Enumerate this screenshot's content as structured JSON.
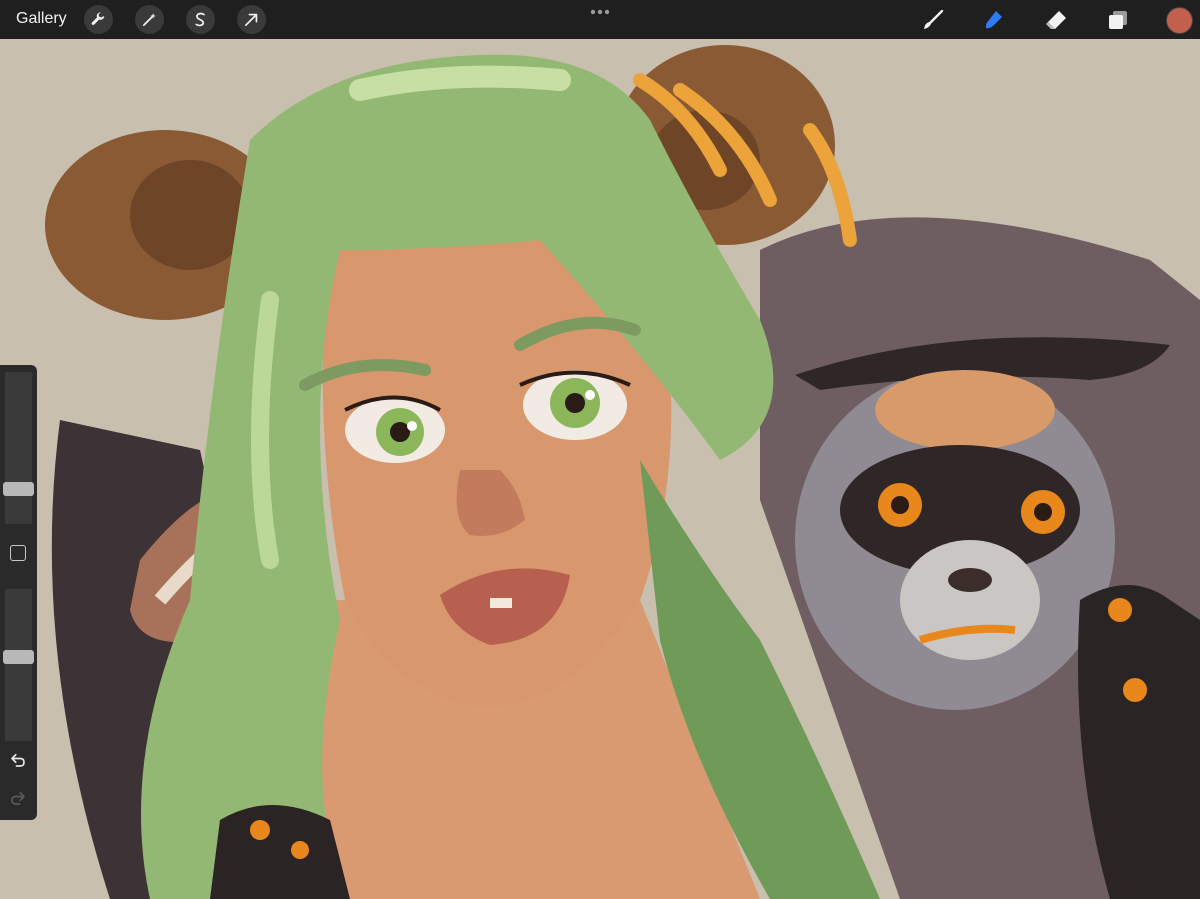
{
  "toolbar": {
    "gallery_label": "Gallery",
    "left_tools": [
      {
        "icon": "wrench-icon"
      },
      {
        "icon": "magic-wand-icon"
      },
      {
        "icon": "selection-s-icon"
      },
      {
        "icon": "transform-arrow-icon"
      }
    ],
    "more_icon": "ellipsis-icon",
    "right_tools": [
      {
        "icon": "brush-icon",
        "active": false
      },
      {
        "icon": "smudge-icon",
        "active": true
      },
      {
        "icon": "eraser-icon",
        "active": false
      },
      {
        "icon": "layers-icon",
        "active": false
      }
    ],
    "current_color": "#c2604d",
    "active_tool_color": "#2d7cf6"
  },
  "sidebar": {
    "brush_size_level": 0.2,
    "opacity_level": 0.56
  },
  "colors": {
    "canvas_bg": "#c8bfae",
    "hair": "#93b873",
    "skin": "#d9976e",
    "lips": "#b8604f",
    "horn": "#8a5a35",
    "lemur_fur": "#908a93",
    "lemur_eye": "#e8871b",
    "ribbon": "#eba33a"
  }
}
